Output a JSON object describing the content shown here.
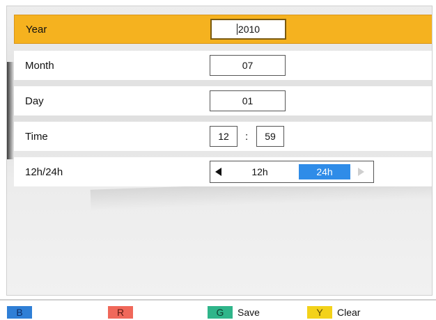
{
  "rows": [
    {
      "label": "Year",
      "value": "2010",
      "selected": true
    },
    {
      "label": "Month",
      "value": "07"
    },
    {
      "label": "Day",
      "value": "01"
    },
    {
      "label": "Time",
      "hour": "12",
      "separator": ":",
      "minute": "59"
    },
    {
      "label": "12h/24h",
      "options": [
        "12h",
        "24h"
      ],
      "selected_option": "24h"
    }
  ],
  "footer": {
    "keys": [
      {
        "key": "B",
        "color": "#2f7fd6",
        "label": ""
      },
      {
        "key": "R",
        "color": "#f0685a",
        "label": ""
      },
      {
        "key": "G",
        "color": "#2fb58a",
        "label": "Save"
      },
      {
        "key": "Y",
        "color": "#f3d21a",
        "label": "Clear"
      }
    ]
  },
  "colors": {
    "selected_row": "#f5b21f",
    "toggle_active": "#2f8ce8"
  }
}
